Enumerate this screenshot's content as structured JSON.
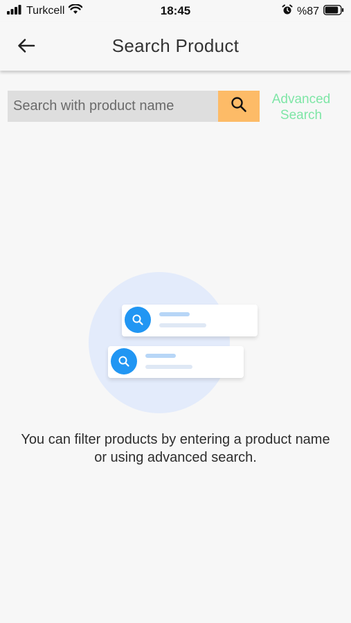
{
  "status_bar": {
    "carrier": "Turkcell",
    "time": "18:45",
    "battery_percent": "%87",
    "battery_level": 0.87,
    "icons": [
      "signal-icon",
      "wifi-icon",
      "alarm-icon",
      "battery-icon"
    ]
  },
  "app_bar": {
    "title": "Search Product",
    "back_icon": "back-arrow-icon"
  },
  "search": {
    "placeholder": "Search with product name",
    "value": "",
    "button_icon": "search-icon"
  },
  "advanced_search": {
    "label_line1": "Advanced",
    "label_line2": "Search"
  },
  "empty_state": {
    "message": "You can filter products by entering a product name or using advanced search."
  },
  "colors": {
    "background": "#f7f7f7",
    "search_field": "#dedede",
    "search_button": "#fdbb67",
    "advanced_link": "#7ee6a6",
    "illustration_circle": "#e3ebfb",
    "illustration_accent": "#2196f3"
  }
}
